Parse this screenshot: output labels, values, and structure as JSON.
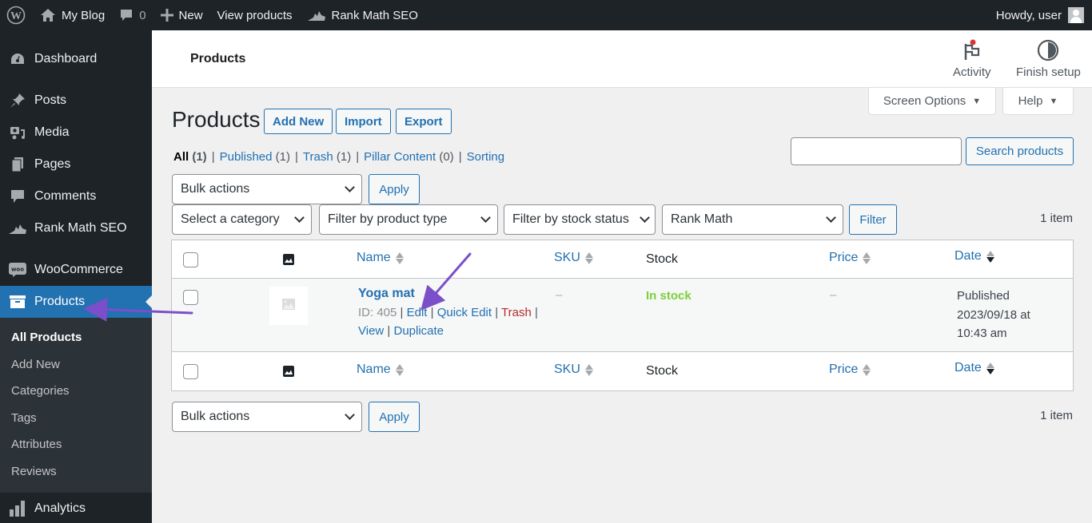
{
  "adminbar": {
    "site_name": "My Blog",
    "comments_count": "0",
    "new_label": "New",
    "view_products": "View products",
    "rank_math": "Rank Math SEO",
    "howdy": "Howdy, user"
  },
  "sidebar": {
    "items": [
      {
        "label": "Dashboard",
        "icon": "dashboard-icon"
      },
      {
        "label": "Posts",
        "icon": "pin-icon"
      },
      {
        "label": "Media",
        "icon": "media-icon"
      },
      {
        "label": "Pages",
        "icon": "pages-icon"
      },
      {
        "label": "Comments",
        "icon": "comment-icon"
      },
      {
        "label": "Rank Math SEO",
        "icon": "rank-math-icon"
      },
      {
        "label": "WooCommerce",
        "icon": "woo-icon"
      },
      {
        "label": "Products",
        "icon": "archive-icon"
      },
      {
        "label": "Analytics",
        "icon": "bar-chart-icon"
      }
    ],
    "submenu": [
      "All Products",
      "Add New",
      "Categories",
      "Tags",
      "Attributes",
      "Reviews"
    ]
  },
  "woo_header": {
    "title": "Products",
    "activity": "Activity",
    "finish_setup": "Finish setup"
  },
  "screen_tabs": {
    "screen_options": "Screen Options",
    "help": "Help"
  },
  "page": {
    "title": "Products",
    "add_new": "Add New",
    "import": "Import",
    "export": "Export"
  },
  "views": {
    "all": "All",
    "all_count": "(1)",
    "published": "Published",
    "published_count": "(1)",
    "trash": "Trash",
    "trash_count": "(1)",
    "pillar": "Pillar Content",
    "pillar_count": "(0)",
    "sorting": "Sorting"
  },
  "search": {
    "value": "",
    "button": "Search products"
  },
  "tablenav_top": {
    "bulk_actions": "Bulk actions",
    "apply": "Apply",
    "category": "Select a category",
    "product_type": "Filter by product type",
    "stock_status": "Filter by stock status",
    "rank_math": "Rank Math",
    "filter": "Filter",
    "items": "1 item"
  },
  "table": {
    "columns": {
      "name": "Name",
      "sku": "SKU",
      "stock": "Stock",
      "price": "Price",
      "date": "Date"
    },
    "rows": [
      {
        "name": "Yoga mat",
        "id": "ID: 405",
        "edit": "Edit",
        "quick_edit": "Quick Edit",
        "trash": "Trash",
        "view": "View",
        "duplicate": "Duplicate",
        "sku": "–",
        "stock": "In stock",
        "price": "–",
        "date_status": "Published",
        "date_line1": "2023/09/18 at",
        "date_line2": "10:43 am"
      }
    ]
  },
  "tablenav_bottom": {
    "bulk_actions": "Bulk actions",
    "apply": "Apply",
    "items": "1 item"
  },
  "colors": {
    "accent": "#2271b1",
    "sidebar_bg": "#1d2327",
    "in_stock": "#7ad03a",
    "trash": "#b32d2e",
    "annotation": "#7b4fc9"
  }
}
